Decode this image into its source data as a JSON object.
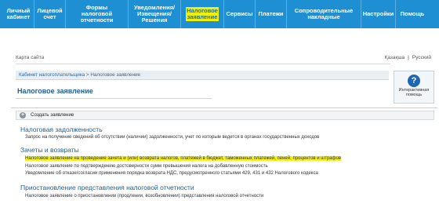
{
  "nav": {
    "items": [
      {
        "label": "Личный\nкабинет"
      },
      {
        "label": "Лицевой\nсчет"
      },
      {
        "label": "Формы\nналоговой\nотчетности"
      },
      {
        "label": "Уведомления/\nИзвещения/\nРешения"
      },
      {
        "label": "Налоговое\nзаявление"
      },
      {
        "label": "Сервисы"
      },
      {
        "label": "Платежи"
      },
      {
        "label": "Сопроводительные\nнакладные"
      },
      {
        "label": "Настройки"
      },
      {
        "label": "Помощь"
      }
    ],
    "active_index": 4
  },
  "util": {
    "sitemap": "Карта сайта",
    "lang_kz": "Қазақша",
    "separator": "|",
    "lang_ru": "Русский"
  },
  "breadcrumb": {
    "parent": "Кабинет налогоплательщика",
    "sep": " > ",
    "current": "Налоговое заявление"
  },
  "page_title": "Налоговое заявление",
  "help": {
    "icon": "?",
    "label": "Интерактивная помощь"
  },
  "create": {
    "icon": "+",
    "label": "Создать заявление"
  },
  "groups": [
    {
      "title": "Налоговая задолженность",
      "items": [
        "Запрос на получение сведений об отсутствии (наличии) задолженности, учет по которым ведется в органах государственных доходов"
      ]
    },
    {
      "title": "Зачеты и возвраты",
      "items": [
        "Налоговое заявление на проведение зачета и (или) возврата налогов, платежей в бюджет, таможенных платежей, пеней, процентов и штрафов",
        "Налоговое заявление по подтверждению достоверности сумм превышения налога на добавленную стоимость",
        "Уведомление об отказе/согласии применения порядка возврата НДС, предусмотренного статьями 429, 431 и 432 Налогового кодекса"
      ]
    },
    {
      "title": "Приостановление представления налоговой отчетности",
      "items": [
        "Налоговое заявление о приостановлении (продлении, возобновлении) представления налоговой отчетности"
      ]
    }
  ]
}
